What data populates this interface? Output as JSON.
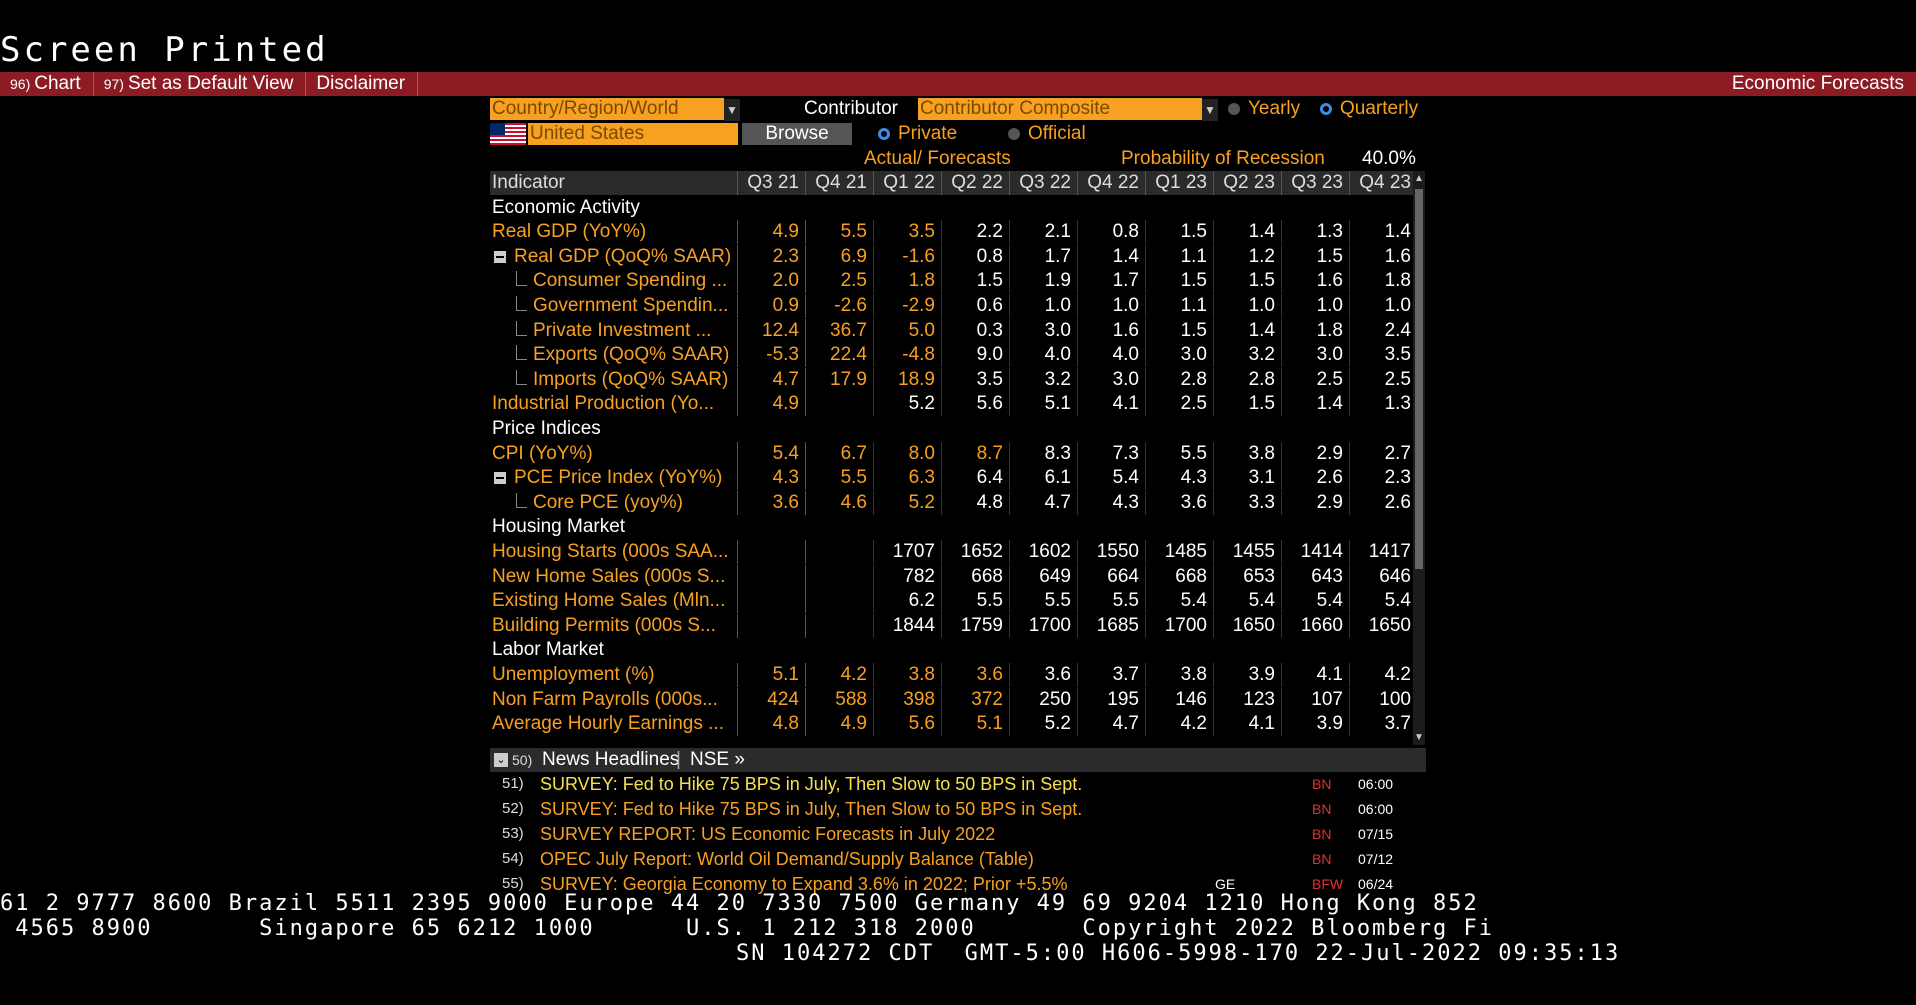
{
  "header": {
    "title": "Screen Printed"
  },
  "toolbar": {
    "items": [
      {
        "num": "96)",
        "label": "Chart"
      },
      {
        "num": "97)",
        "label": "Set as Default View"
      },
      {
        "num": "",
        "label": "Disclaimer"
      }
    ],
    "right_label": "Economic Forecasts"
  },
  "controls": {
    "region_select": "Country/Region/World",
    "contributor_label": "Contributor",
    "contributor_select": "Contributor Composite",
    "period_options": [
      "Yearly",
      "Quarterly"
    ],
    "period_selected": "Quarterly",
    "country": "United States",
    "browse_label": "Browse",
    "source_options": [
      "Private",
      "Official"
    ],
    "source_selected": "Private",
    "actual_forecasts_label": "Actual/ Forecasts",
    "recession_label": "Probability of Recession",
    "recession_value": "40.0%"
  },
  "table": {
    "header_label": "Indicator",
    "columns": [
      "Q3 21",
      "Q4 21",
      "Q1 22",
      "Q2 22",
      "Q3 22",
      "Q4 22",
      "Q1 23",
      "Q2 23",
      "Q3 23",
      "Q4 23"
    ],
    "rows": [
      {
        "type": "section",
        "label": "Economic Activity"
      },
      {
        "type": "row",
        "label": "Real GDP (YoY%)",
        "indent": 0,
        "values": [
          "4.9",
          "5.5",
          "3.5",
          "2.2",
          "2.1",
          "0.8",
          "1.5",
          "1.4",
          "1.3",
          "1.4"
        ],
        "actual": 3
      },
      {
        "type": "row",
        "label": "Real GDP (QoQ% SAAR)",
        "indent": 1,
        "values": [
          "2.3",
          "6.9",
          "-1.6",
          "0.8",
          "1.7",
          "1.4",
          "1.1",
          "1.2",
          "1.5",
          "1.6"
        ],
        "actual": 3
      },
      {
        "type": "row",
        "label": "Consumer Spending ...",
        "indent": 2,
        "values": [
          "2.0",
          "2.5",
          "1.8",
          "1.5",
          "1.9",
          "1.7",
          "1.5",
          "1.5",
          "1.6",
          "1.8"
        ],
        "actual": 3
      },
      {
        "type": "row",
        "label": "Government Spendin...",
        "indent": 2,
        "values": [
          "0.9",
          "-2.6",
          "-2.9",
          "0.6",
          "1.0",
          "1.0",
          "1.1",
          "1.0",
          "1.0",
          "1.0"
        ],
        "actual": 3
      },
      {
        "type": "row",
        "label": "Private Investment ...",
        "indent": 2,
        "values": [
          "12.4",
          "36.7",
          "5.0",
          "0.3",
          "3.0",
          "1.6",
          "1.5",
          "1.4",
          "1.8",
          "2.4"
        ],
        "actual": 3
      },
      {
        "type": "row",
        "label": "Exports (QoQ% SAAR)",
        "indent": 2,
        "values": [
          "-5.3",
          "22.4",
          "-4.8",
          "9.0",
          "4.0",
          "4.0",
          "3.0",
          "3.2",
          "3.0",
          "3.5"
        ],
        "actual": 3
      },
      {
        "type": "row",
        "label": "Imports (QoQ% SAAR)",
        "indent": 2,
        "values": [
          "4.7",
          "17.9",
          "18.9",
          "3.5",
          "3.2",
          "3.0",
          "2.8",
          "2.8",
          "2.5",
          "2.5"
        ],
        "actual": 3
      },
      {
        "type": "row",
        "label": "Industrial Production (Yo...",
        "indent": 0,
        "values": [
          "4.9",
          "",
          "5.2",
          "5.6",
          "5.1",
          "4.1",
          "2.5",
          "1.5",
          "1.4",
          "1.3"
        ],
        "actual": 1
      },
      {
        "type": "section",
        "label": "Price Indices"
      },
      {
        "type": "row",
        "label": "CPI (YoY%)",
        "indent": 0,
        "values": [
          "5.4",
          "6.7",
          "8.0",
          "8.7",
          "8.3",
          "7.3",
          "5.5",
          "3.8",
          "2.9",
          "2.7"
        ],
        "actual": 4
      },
      {
        "type": "row",
        "label": "PCE Price Index (YoY%)",
        "indent": 1,
        "values": [
          "4.3",
          "5.5",
          "6.3",
          "6.4",
          "6.1",
          "5.4",
          "4.3",
          "3.1",
          "2.6",
          "2.3"
        ],
        "actual": 3
      },
      {
        "type": "row",
        "label": "Core PCE (yoy%)",
        "indent": 2,
        "values": [
          "3.6",
          "4.6",
          "5.2",
          "4.8",
          "4.7",
          "4.3",
          "3.6",
          "3.3",
          "2.9",
          "2.6"
        ],
        "actual": 3
      },
      {
        "type": "section",
        "label": "Housing Market"
      },
      {
        "type": "row",
        "label": "Housing Starts (000s SAA...",
        "indent": 0,
        "values": [
          "",
          "",
          "1707",
          "1652",
          "1602",
          "1550",
          "1485",
          "1455",
          "1414",
          "1417"
        ],
        "actual": 0
      },
      {
        "type": "row",
        "label": "New Home Sales (000s S...",
        "indent": 0,
        "values": [
          "",
          "",
          "782",
          "668",
          "649",
          "664",
          "668",
          "653",
          "643",
          "646"
        ],
        "actual": 0
      },
      {
        "type": "row",
        "label": "Existing Home Sales (Mln...",
        "indent": 0,
        "values": [
          "",
          "",
          "6.2",
          "5.5",
          "5.5",
          "5.5",
          "5.4",
          "5.4",
          "5.4",
          "5.4"
        ],
        "actual": 0
      },
      {
        "type": "row",
        "label": "Building Permits (000s S...",
        "indent": 0,
        "values": [
          "",
          "",
          "1844",
          "1759",
          "1700",
          "1685",
          "1700",
          "1650",
          "1660",
          "1650"
        ],
        "actual": 0
      },
      {
        "type": "section",
        "label": "Labor Market"
      },
      {
        "type": "row",
        "label": "Unemployment (%)",
        "indent": 0,
        "values": [
          "5.1",
          "4.2",
          "3.8",
          "3.6",
          "3.6",
          "3.7",
          "3.8",
          "3.9",
          "4.1",
          "4.2"
        ],
        "actual": 4
      },
      {
        "type": "row",
        "label": "Non Farm Payrolls (000s...",
        "indent": 0,
        "values": [
          "424",
          "588",
          "398",
          "372",
          "250",
          "195",
          "146",
          "123",
          "107",
          "100"
        ],
        "actual": 4
      },
      {
        "type": "row",
        "label": "Average Hourly Earnings ...",
        "indent": 0,
        "values": [
          "4.8",
          "4.9",
          "5.6",
          "5.1",
          "5.2",
          "4.7",
          "4.2",
          "4.1",
          "3.9",
          "3.7"
        ],
        "actual": 4
      }
    ]
  },
  "news": {
    "num": "50)",
    "label": "News Headlines",
    "source": "NSE »",
    "items": [
      {
        "num": "51)",
        "text": "SURVEY: Fed to Hike 75 BPS in July, Then Slow to 50 BPS in Sept.",
        "src": "BN",
        "time": "06:00",
        "color": "#f7e04a",
        "ge": ""
      },
      {
        "num": "52)",
        "text": "SURVEY: Fed to Hike 75 BPS in July, Then Slow to 50 BPS in Sept.",
        "src": "BN",
        "time": "06:00",
        "color": "#f7a021",
        "ge": ""
      },
      {
        "num": "53)",
        "text": "SURVEY REPORT: US Economic Forecasts in July 2022",
        "src": "BN",
        "time": "07/15",
        "color": "#f7a021",
        "ge": ""
      },
      {
        "num": "54)",
        "text": "OPEC July Report: World Oil Demand/Supply Balance (Table)",
        "src": "BN",
        "time": "07/12",
        "color": "#f7a021",
        "ge": ""
      },
      {
        "num": "55)",
        "text": "SURVEY: Georgia Economy to Expand 3.6% in 2022; Prior +5.5%",
        "src": "BFW",
        "time": "06/24",
        "color": "#f7a021",
        "ge": "GE"
      }
    ]
  },
  "footer": {
    "line1": "61 2 9777 8600 Brazil 5511 2395 9000 Europe 44 20 7330 7500 Germany 49 69 9204 1210 Hong Kong 852",
    "line2": " 4565 8900       Singapore 65 6212 1000      U.S. 1 212 318 2000       Copyright 2022 Bloomberg Fi",
    "line3": "SN 104272 CDT  GMT-5:00 H606-5998-170 22-Jul-2022 09:35:13"
  },
  "colors": {
    "accent": "#f7a021",
    "toolbar": "#8c1b24",
    "header_bg": "#2b2b2b"
  }
}
